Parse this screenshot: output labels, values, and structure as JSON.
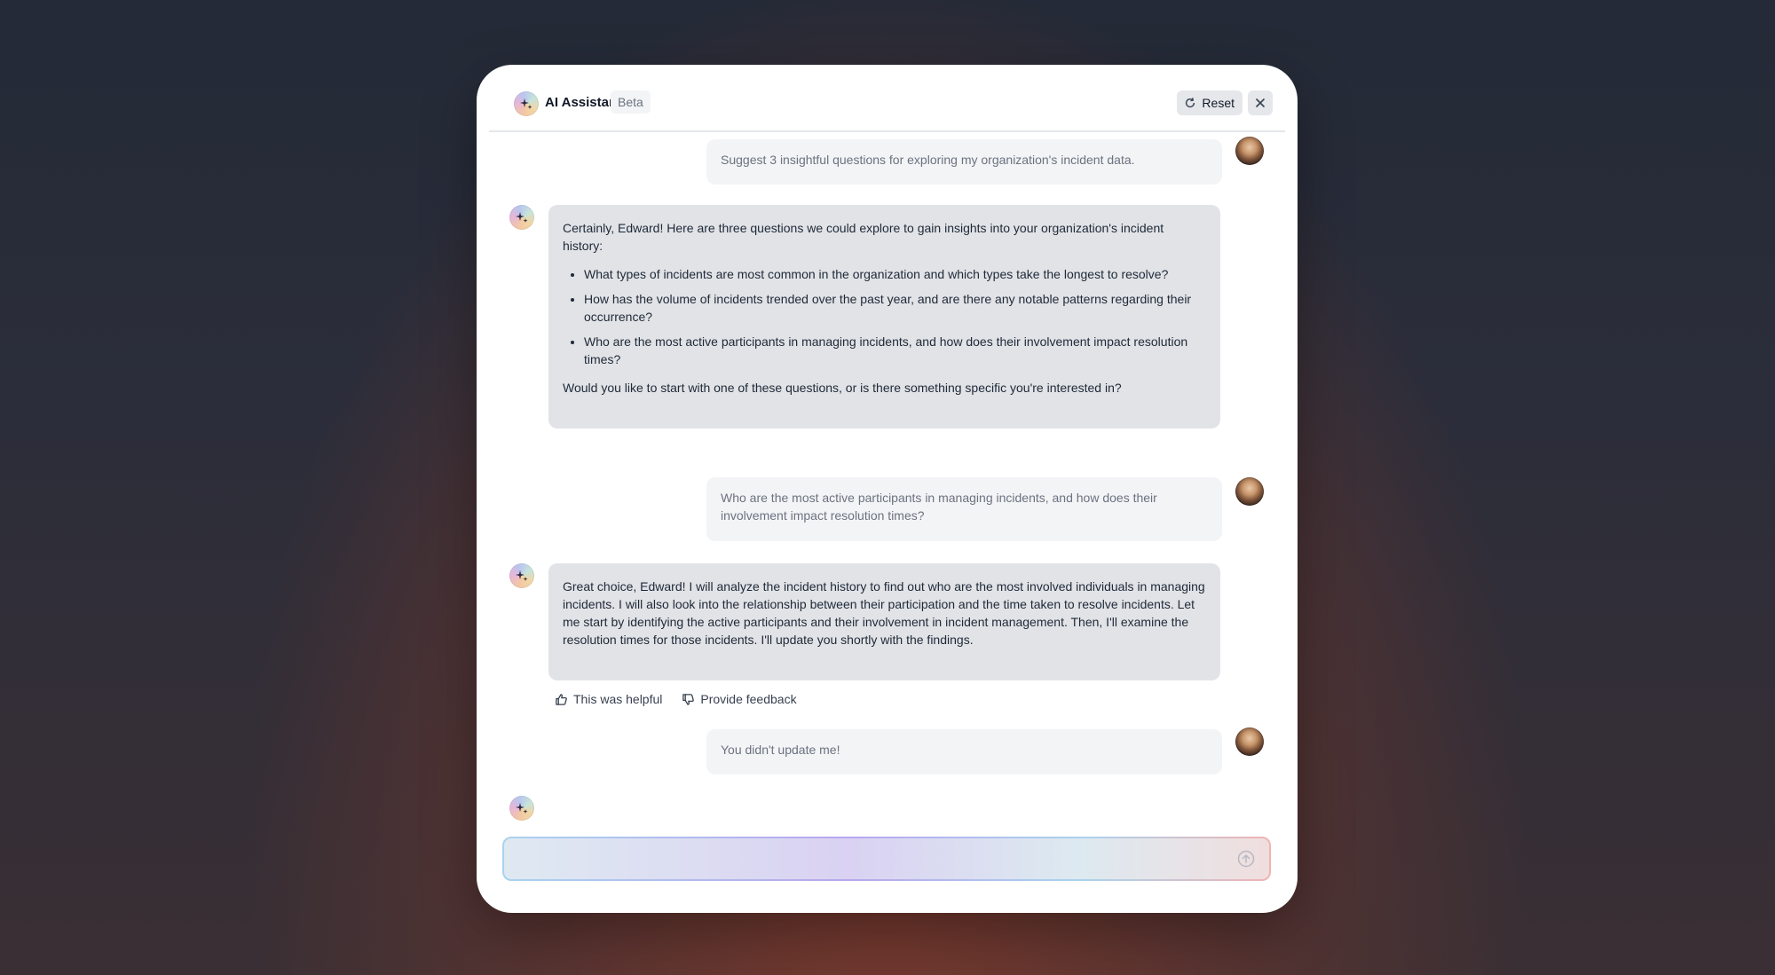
{
  "header": {
    "title": "AI Assistant",
    "badge": "Beta",
    "reset_label": "Reset"
  },
  "messages": [
    {
      "role": "user",
      "text": "Suggest 3 insightful questions for exploring my organization's incident data."
    },
    {
      "role": "assistant",
      "intro": "Certainly, Edward! Here are three questions we could explore to gain insights into your organization's incident history:",
      "items": [
        "What types of incidents are most common in the organization and which types take the longest to resolve?",
        "How has the volume of incidents trended over the past year, and are there any notable patterns regarding their occurrence?",
        "Who are the most active participants in managing incidents, and how does their involvement impact resolution times?"
      ],
      "outro": "Would you like to start with one of these questions, or is there something specific you're interested in?"
    },
    {
      "role": "user",
      "text": "Who are the most active participants in managing incidents, and how does their involvement impact resolution times?"
    },
    {
      "role": "assistant",
      "text": "Great choice, Edward! I will analyze the incident history to find out who are the most involved individuals in managing incidents. I will also look into the relationship between their participation and the time taken to resolve incidents. Let me start by identifying the active participants and their involvement in incident management. Then, I'll examine the resolution times for those incidents. I'll update you shortly with the findings."
    },
    {
      "role": "user",
      "text": "You didn't update me!"
    }
  ],
  "feedback": {
    "helpful_label": "This was helpful",
    "feedback_label": "Provide feedback"
  },
  "composer": {
    "value": "",
    "placeholder": ""
  },
  "icons": {
    "brand": "sparkle-icon",
    "reset": "refresh-icon",
    "close": "close-icon",
    "thumbs_up": "thumbs-up-icon",
    "thumbs_down": "thumbs-down-icon",
    "send": "arrow-up-circle-icon"
  }
}
